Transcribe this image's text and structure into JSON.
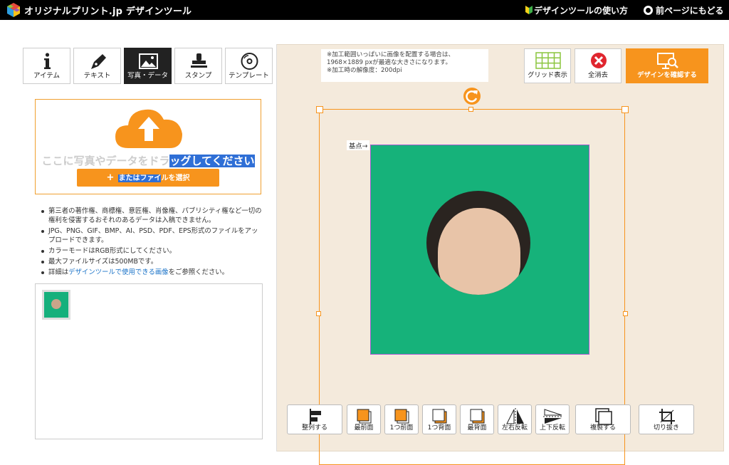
{
  "header": {
    "site_title": "オリジナルプリント.jp デザインツール",
    "help_link": "デザインツールの使い方",
    "back_link": "前ページにもどる"
  },
  "tabs": [
    {
      "label": "アイテム",
      "icon": "info-icon",
      "active": false
    },
    {
      "label": "テキスト",
      "icon": "pen-icon",
      "active": false
    },
    {
      "label": "写真・データ",
      "icon": "image-icon",
      "active": true
    },
    {
      "label": "スタンプ",
      "icon": "stamp-icon",
      "active": false
    },
    {
      "label": "テンプレート",
      "icon": "template-icon",
      "active": false
    }
  ],
  "upload": {
    "drop_text_plain": "ここに写真やデータをドラ",
    "drop_text_selected": "ッグしてください",
    "button_plus": "+",
    "button_text_selected": "またはファイ",
    "button_text_plain": "ルを選択"
  },
  "notes": [
    "第三者の著作権、商標権、意匠権、肖像権、パブリシティ権など一切の権利を侵害するおそれのあるデータは入稿できません。",
    "JPG、PNG、GIF、BMP、AI、PSD、PDF、EPS形式のファイルをアップロードできます。",
    "カラーモードはRGB形式にしてください。",
    "最大ファイルサイズは500MBです。"
  ],
  "notes_last": {
    "prefix": "詳細は",
    "link": "デザインツールで使用できる画像",
    "suffix": "をご参照ください。"
  },
  "canvas_info": [
    "※加工範囲いっぱいに画像を配置する場合は、",
    "1968×1889 pxが最適な大きさになります。",
    "※加工時の解像度：200dpi"
  ],
  "toolbar": {
    "grid": "グリッド表示",
    "clear": "全消去",
    "confirm": "デザインを確認する"
  },
  "origin_label": "基点→",
  "bottom_tools": [
    {
      "label": "整列する",
      "icon": "align-icon"
    },
    {
      "label": "最前面",
      "icon": "bring-front-icon"
    },
    {
      "label": "1つ前面",
      "icon": "bring-forward-icon"
    },
    {
      "label": "1つ背面",
      "icon": "send-backward-icon"
    },
    {
      "label": "最背面",
      "icon": "send-back-icon"
    },
    {
      "label": "左右反転",
      "icon": "flip-horizontal-icon"
    },
    {
      "label": "上下反転",
      "icon": "flip-vertical-icon"
    },
    {
      "label": "複製する",
      "icon": "duplicate-icon"
    },
    {
      "label": "切り抜き",
      "icon": "crop-icon"
    }
  ],
  "colors": {
    "accent": "#f7941d",
    "selection": "#2f6fd6",
    "canvas_bg": "#f4eadc",
    "photo_green": "#16b27a"
  }
}
